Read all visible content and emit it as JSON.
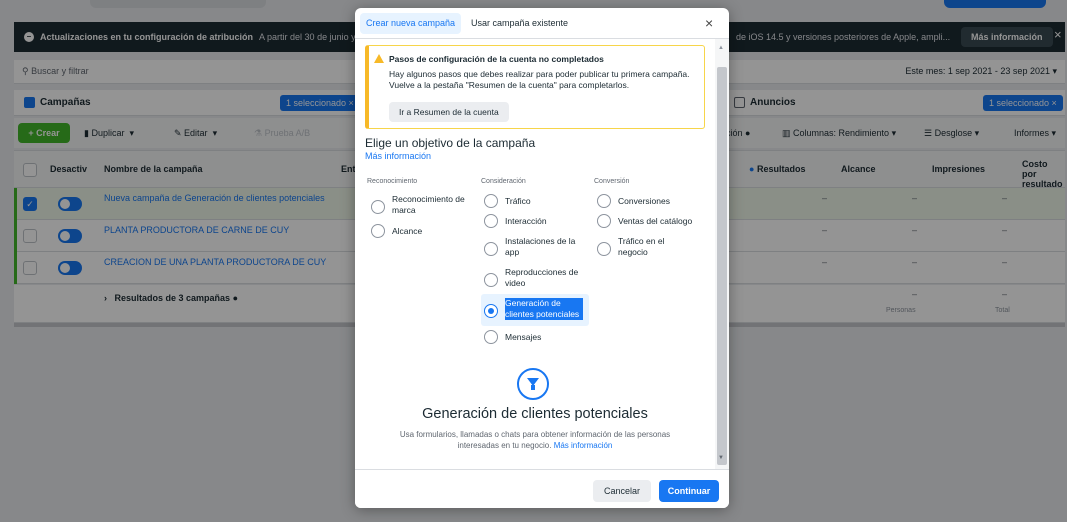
{
  "notice": {
    "title": "Actualizaciones en tu configuración de atribución",
    "text": "A partir del 30 de junio y com",
    "text_right": "de iOS 14.5 y versiones posteriores de Apple, ampli...",
    "more_button": "Más información",
    "close": "×"
  },
  "search": {
    "placeholder": "Buscar y filtrar",
    "date_range": "Este mes: 1 sep 2021 - 23 sep 2021"
  },
  "tabs": {
    "campaigns": "Campañas",
    "campaigns_selected": "1 seleccionado ×",
    "ads": "Anuncios",
    "ads_selected": "1 seleccionado ×"
  },
  "toolbar": {
    "create": "+ Crear",
    "duplicate": "Duplicar",
    "edit": "Editar",
    "ab_test": "Prueba A/B",
    "cols_left": "ción",
    "columns": "Columnas: Rendimiento",
    "breakdown": "Desglose",
    "reports": "Informes"
  },
  "table": {
    "headers": {
      "toggle": "Desactiv",
      "name": "Nombre de la campaña",
      "delivery": "Ent",
      "results": "Resultados",
      "reach": "Alcance",
      "impressions": "Impresiones",
      "cost": "Costo por resultado"
    },
    "rows": [
      {
        "name": "Nueva campaña de Generación de clientes potenciales",
        "dash": "–"
      },
      {
        "name": "PLANTA PRODUCTORA DE CARNE DE CUY",
        "dash": "–"
      },
      {
        "name": "CREACION DE UNA PLANTA PRODUCTORA DE CUY",
        "dash": "–"
      }
    ],
    "total_label": "Resultados de 3 campañas",
    "total_reach_sub": "Personas",
    "total_impr_sub": "Total",
    "total_dash": "–"
  },
  "modal": {
    "tab_new": "Crear nueva campaña",
    "tab_existing": "Usar campaña existente",
    "close": "×",
    "warning_title": "Pasos de configuración de la cuenta no completados",
    "warning_body": "Hay algunos pasos que debes realizar para poder publicar tu primera campaña. Vuelve a la pestaña \"Resumen de la cuenta\" para completarlos.",
    "warning_button": "Ir a Resumen de la cuenta",
    "objective_title": "Elige un objetivo de la campaña",
    "objective_link": "Más información",
    "columns": {
      "awareness": "Reconocimiento",
      "consideration": "Consideración",
      "conversion": "Conversión"
    },
    "options": {
      "brand_awareness": "Reconocimiento de marca",
      "reach": "Alcance",
      "traffic": "Tráfico",
      "engagement": "Interacción",
      "app_installs": "Instalaciones de la app",
      "video_views": "Reproducciones de video",
      "lead_gen": "Generación de clientes potenciales",
      "messages": "Mensajes",
      "conversions": "Conversiones",
      "catalog_sales": "Ventas del catálogo",
      "store_traffic": "Tráfico en el negocio"
    },
    "selected_title": "Generación de clientes potenciales",
    "selected_desc": "Usa formularios, llamadas o chats para obtener información de las personas interesadas en tu negocio.",
    "selected_link": "Más información",
    "cancel": "Cancelar",
    "continue": "Continuar"
  }
}
